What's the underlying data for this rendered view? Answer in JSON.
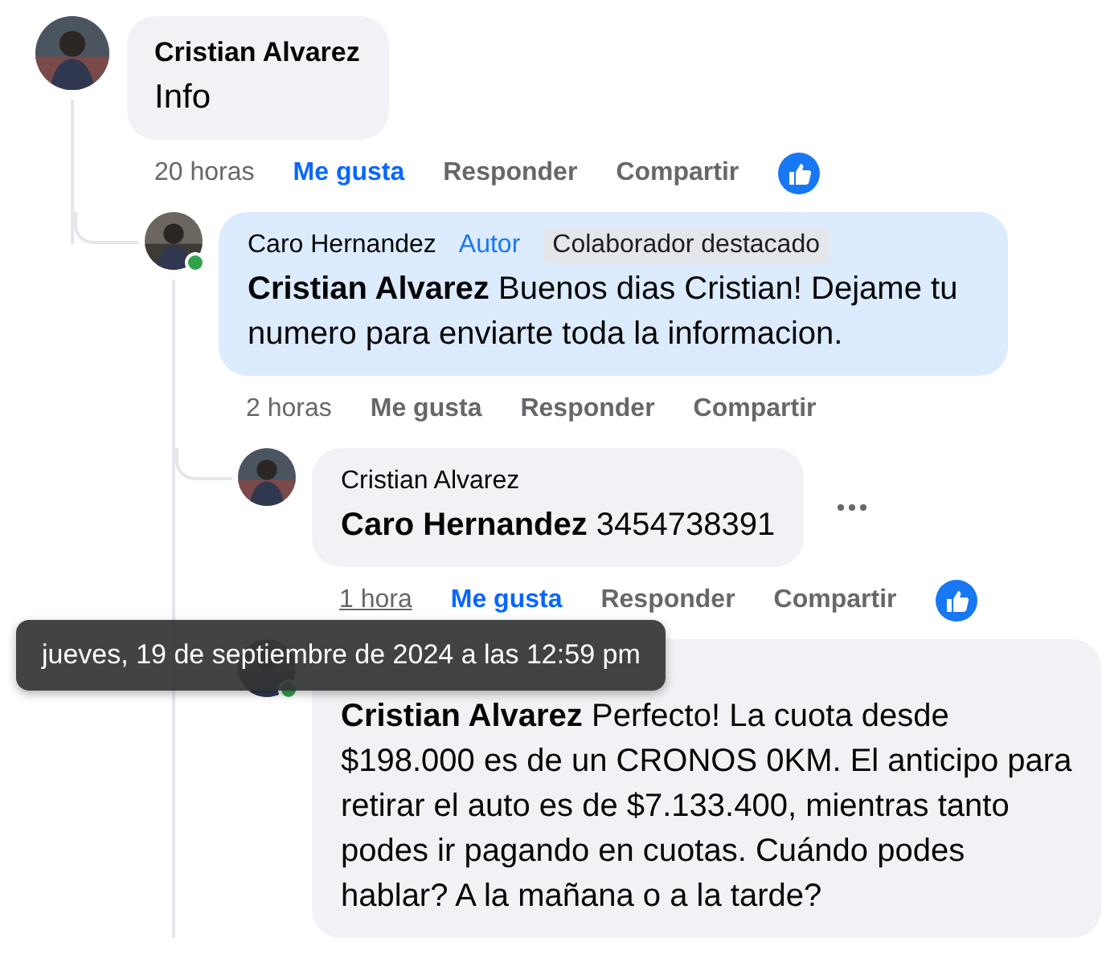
{
  "comments": [
    {
      "author": "Cristian Alvarez",
      "text": "Info",
      "online": false,
      "highlighted": false,
      "time": "20 horas",
      "time_hovered": false,
      "actions": {
        "like": "Me gusta",
        "reply": "Responder",
        "share": "Compartir"
      },
      "liked": true,
      "has_reaction": true,
      "children": [
        {
          "author": "Caro Hernandez",
          "mention": "Cristian Alvarez",
          "text": "Buenos dias Cristian! Dejame tu numero para enviarte toda la informacion.",
          "online": true,
          "highlighted": true,
          "badges": [
            {
              "kind": "author",
              "label": "Autor"
            },
            {
              "kind": "featured",
              "label": "Colaborador destacado"
            }
          ],
          "time": "2 horas",
          "time_hovered": false,
          "actions": {
            "like": "Me gusta",
            "reply": "Responder",
            "share": "Compartir"
          },
          "liked": false,
          "has_reaction": false,
          "children": [
            {
              "author": "Cristian Alvarez",
              "mention": "Caro Hernandez",
              "text": "3454738391",
              "online": false,
              "highlighted": false,
              "show_menu": true,
              "time": "1 hora",
              "time_hovered": true,
              "actions": {
                "like": "Me gusta",
                "reply": "Responder",
                "share": "Compartir"
              },
              "liked": true,
              "has_reaction": true
            },
            {
              "mention": "Cristian Alvarez",
              "text": "Perfecto! La cuota desde $198.000 es de un CRONOS 0KM. El anticipo para retirar el auto es de $7.133.400, mientras tanto podes ir pagando en cuotas. Cuándo podes hablar? A la mañana o a la tarde?",
              "online": true,
              "highlighted": false
            }
          ]
        }
      ]
    }
  ],
  "tooltip": {
    "text": "jueves, 19 de septiembre de 2024 a las 12:59 pm"
  }
}
